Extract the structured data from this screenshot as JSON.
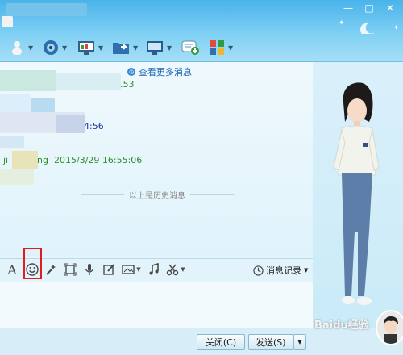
{
  "window": {
    "controls": [
      "—",
      "□",
      "✕"
    ]
  },
  "toolbar": {
    "items": [
      {
        "icon": "user-icon"
      },
      {
        "icon": "video-call-icon"
      },
      {
        "icon": "remote-desktop-icon"
      },
      {
        "icon": "file-transfer-icon"
      },
      {
        "icon": "screen-share-icon"
      },
      {
        "icon": "create-group-icon"
      },
      {
        "icon": "app-grid-icon"
      }
    ]
  },
  "chat": {
    "more_messages": "查看更多消息",
    "messages": [
      {
        "time_fragment": ".53"
      },
      {
        "time_fragment": "4:56"
      },
      {
        "sender_fragment": "ji",
        "name_fragment": "ng",
        "timestamp": "2015/3/29 16:55:06"
      }
    ],
    "history_divider": "以上是历史消息"
  },
  "input_toolbar": {
    "icons": [
      "font-icon",
      "emoji-icon",
      "magic-icon",
      "screenshot-icon",
      "voice-icon",
      "edit-image-icon",
      "image-icon",
      "music-icon",
      "scissors-icon"
    ],
    "message_history_label": "消息记录"
  },
  "bottom": {
    "close_label": "关闭(C)",
    "send_label": "发送(S)"
  },
  "watermark": "Baidu经验",
  "colors": {
    "title_bar": "#49b3ea",
    "link": "#1a64b7",
    "highlight": "#e21b1b",
    "timestamp_green": "#2a8f2a"
  }
}
